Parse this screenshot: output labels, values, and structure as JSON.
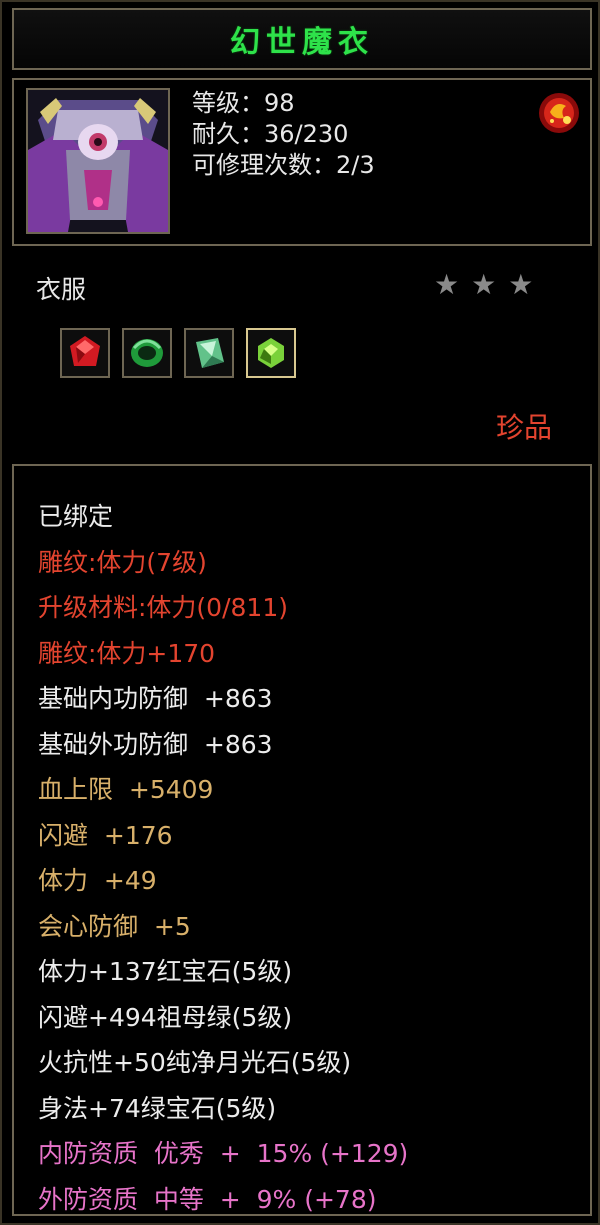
{
  "item": {
    "name": "幻世魔衣",
    "icon": "armor-icon",
    "rank_icon": "gem-badge-icon",
    "stats": {
      "level": "等级：98",
      "durability": "耐久：36/230",
      "repair": "可修理次数：2/3"
    },
    "category": "衣服",
    "stars": {
      "filled": 0,
      "total": 3
    },
    "sockets": [
      {
        "name": "ruby-gem-icon",
        "color": "#d21a22"
      },
      {
        "name": "emerald-gem-icon",
        "color": "#1f9a3a"
      },
      {
        "name": "moonstone-gem-icon",
        "color": "#62c28a"
      },
      {
        "name": "green-gem-icon",
        "color": "#7ad13a"
      }
    ],
    "rarity": "珍品"
  },
  "details": {
    "lines": [
      {
        "text": "已绑定",
        "color": "white"
      },
      {
        "text": "雕纹:体力(7级)",
        "color": "red"
      },
      {
        "text": "升级材料:体力(0/811)",
        "color": "red"
      },
      {
        "text": "雕纹:体力+170",
        "color": "red"
      },
      {
        "text": "基础内功防御  +863",
        "color": "white"
      },
      {
        "text": "基础外功防御  +863",
        "color": "white"
      },
      {
        "text": "血上限  +5409",
        "color": "gold"
      },
      {
        "text": "闪避  +176",
        "color": "gold"
      },
      {
        "text": "体力  +49",
        "color": "gold"
      },
      {
        "text": "会心防御  +5",
        "color": "gold"
      },
      {
        "text": "体力+137红宝石(5级)",
        "color": "white"
      },
      {
        "text": "闪避+494祖母绿(5级)",
        "color": "white"
      },
      {
        "text": "火抗性+50纯净月光石(5级)",
        "color": "white"
      },
      {
        "text": "身法+74绿宝石(5级)",
        "color": "white"
      },
      {
        "text": "内防资质  优秀  +  15% (+129)",
        "color": "pink"
      },
      {
        "text": "外防资质  中等  +  9% (+78)",
        "color": "pink"
      }
    ]
  }
}
